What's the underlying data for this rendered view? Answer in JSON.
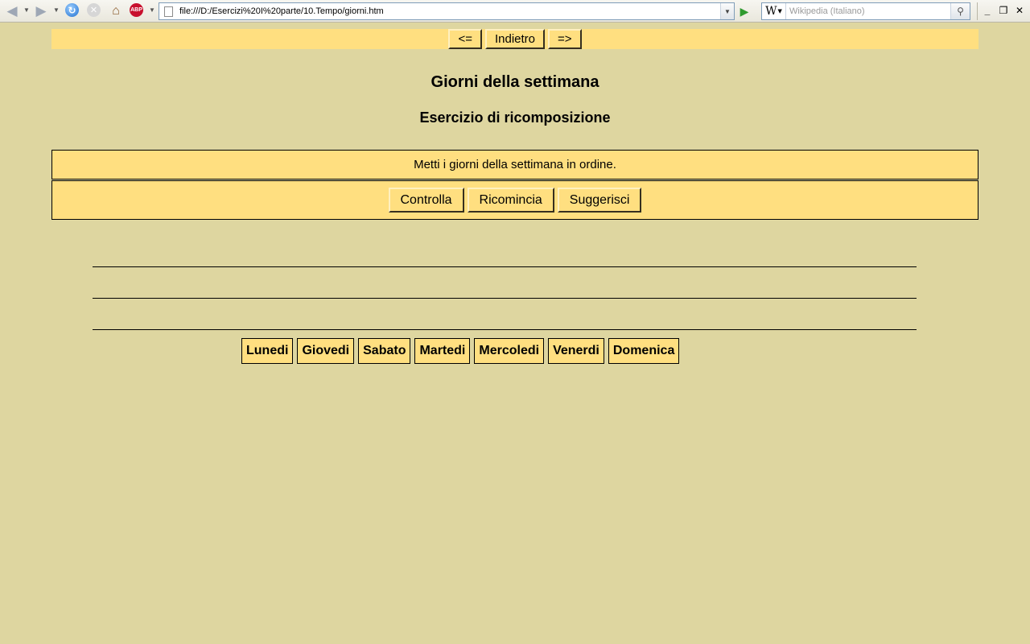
{
  "browser": {
    "url": "file:///D:/Esercizi%20I%20parte/10.Tempo/giorni.htm",
    "search_engine_icon": "W",
    "search_placeholder": "Wikipedia (Italiano)",
    "abp_label": "ABP",
    "icons": {
      "back": "back-arrow-icon",
      "forward": "forward-arrow-icon",
      "reload": "reload-icon",
      "stop": "stop-icon",
      "home": "home-icon",
      "adblock": "adblock-plus-icon",
      "go": "go-arrow-icon",
      "search": "magnifier-icon",
      "minimize": "minimize-icon",
      "restore": "restore-icon",
      "close": "close-icon"
    }
  },
  "nav": {
    "prev_label": "<=",
    "back_label": "Indietro",
    "next_label": "=>"
  },
  "page": {
    "title": "Giorni della settimana",
    "subtitle": "Esercizio di ricomposizione",
    "instructions": "Metti i giorni della settimana in ordine."
  },
  "actions": {
    "check_label": "Controlla",
    "restart_label": "Ricomincia",
    "hint_label": "Suggerisci"
  },
  "tiles": [
    "Lunedi",
    "Giovedi",
    "Sabato",
    "Martedi",
    "Mercoledi",
    "Venerdi",
    "Domenica"
  ],
  "colors": {
    "page_background": "#ded6a0",
    "panel_background": "#ffdf80",
    "border": "#000000"
  }
}
